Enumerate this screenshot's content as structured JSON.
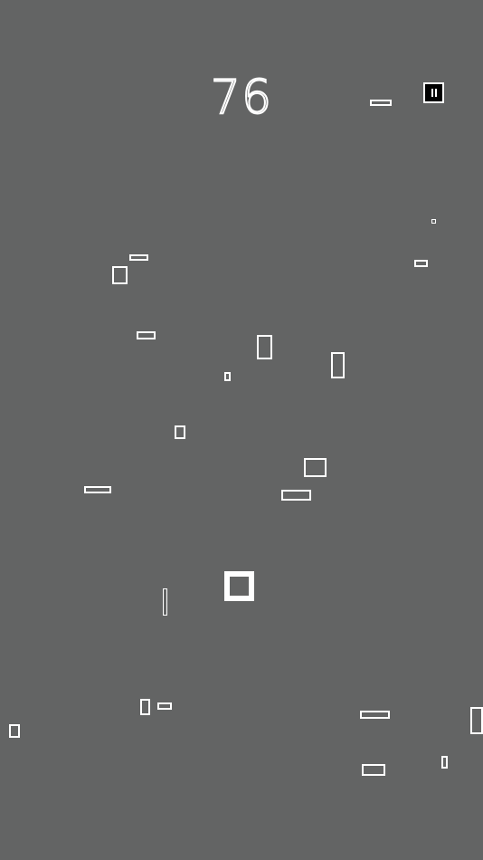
{
  "hud": {
    "score": "76",
    "pause_icon": "pause-icon"
  },
  "colors": {
    "background": "#636464",
    "outline": "#ffffff",
    "pause_fill": "#000000"
  }
}
